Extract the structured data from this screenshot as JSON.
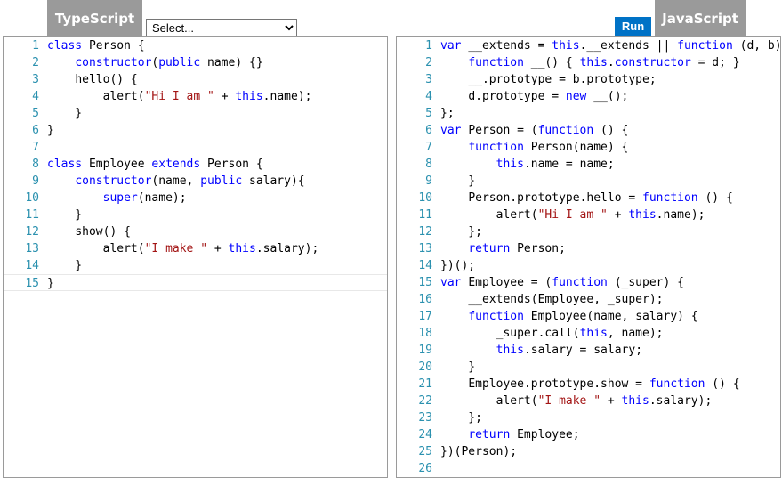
{
  "tabs": {
    "typescript": "TypeScript",
    "javascript": "JavaScript"
  },
  "select": {
    "value": "Select..."
  },
  "run_label": "Run",
  "colors": {
    "tab_bg": "#9a9a9a",
    "run_bg": "#0072c6",
    "keyword": "#0000ff",
    "string": "#a31515",
    "line_number": "#2b91af"
  },
  "typescript_code": [
    "class Person {",
    "    constructor(public name) {}",
    "    hello() {",
    "        alert(\"Hi I am \" + this.name);",
    "    }",
    "}",
    "",
    "class Employee extends Person {",
    "    constructor(name, public salary){",
    "        super(name);",
    "    }",
    "    show() {",
    "        alert(\"I make \" + this.salary);",
    "    }",
    "}"
  ],
  "javascript_code": [
    "var __extends = this.__extends || function (d, b)",
    "    function __() { this.constructor = d; }",
    "    __.prototype = b.prototype;",
    "    d.prototype = new __();",
    "};",
    "var Person = (function () {",
    "    function Person(name) {",
    "        this.name = name;",
    "    }",
    "    Person.prototype.hello = function () {",
    "        alert(\"Hi I am \" + this.name);",
    "    };",
    "    return Person;",
    "})();",
    "var Employee = (function (_super) {",
    "    __extends(Employee, _super);",
    "    function Employee(name, salary) {",
    "        _super.call(this, name);",
    "        this.salary = salary;",
    "    }",
    "    Employee.prototype.show = function () {",
    "        alert(\"I make \" + this.salary);",
    "    };",
    "    return Employee;",
    "})(Person);",
    ""
  ],
  "keywords": [
    "class",
    "extends",
    "constructor",
    "public",
    "super",
    "this",
    "var",
    "function",
    "new",
    "return"
  ]
}
